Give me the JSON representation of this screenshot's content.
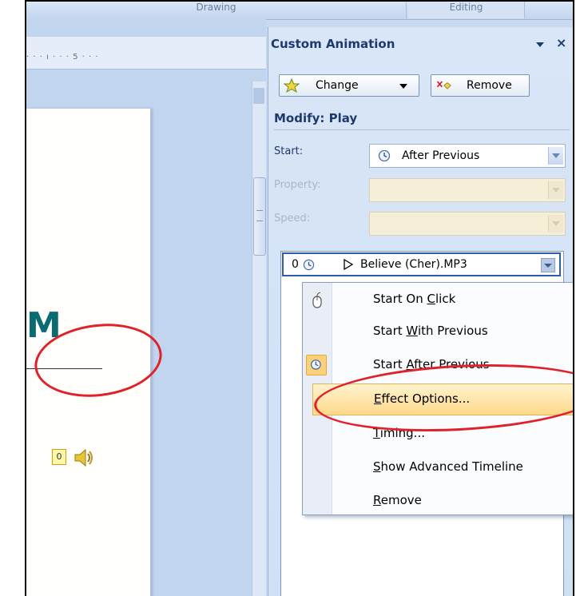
{
  "ribbon": {
    "group1_label": "Drawing",
    "group2_label": "Editing"
  },
  "ruler": {
    "marks": "· · · ı · · · 5 · · ·"
  },
  "slide": {
    "title_fragment": "M",
    "audio_order_badge": "0",
    "speaker_icon": "speaker-icon"
  },
  "task_pane": {
    "title": "Custom Animation",
    "close_glyph": "×",
    "change_button": "Change",
    "remove_button": "Remove",
    "modify_heading": "Modify: Play",
    "start_label": "Start:",
    "start_value": "After Previous",
    "property_label": "Property:",
    "speed_label": "Speed:",
    "list": [
      {
        "order": "0",
        "name": "Believe (Cher).MP3"
      }
    ]
  },
  "context_menu": {
    "items": [
      {
        "pre": "Start On ",
        "key": "C",
        "post": "lick",
        "icon": "mouse-icon"
      },
      {
        "pre": "Start ",
        "key": "W",
        "post": "ith Previous",
        "icon": ""
      },
      {
        "pre": "Start ",
        "key": "A",
        "post": "fter Previous",
        "icon": "clock-icon"
      },
      {
        "pre": "",
        "key": "E",
        "post": "ffect Options...",
        "icon": ""
      },
      {
        "pre": "",
        "key": "T",
        "post": "iming...",
        "icon": ""
      },
      {
        "pre": "",
        "key": "S",
        "post": "how Advanced Timeline",
        "icon": ""
      },
      {
        "pre": "",
        "key": "R",
        "post": "emove",
        "icon": ""
      }
    ]
  },
  "colors": {
    "callout": "#e0202a",
    "highlight": "#ffd98a",
    "pane_title": "#1d3a6e",
    "slide_title": "#0a6b72"
  }
}
